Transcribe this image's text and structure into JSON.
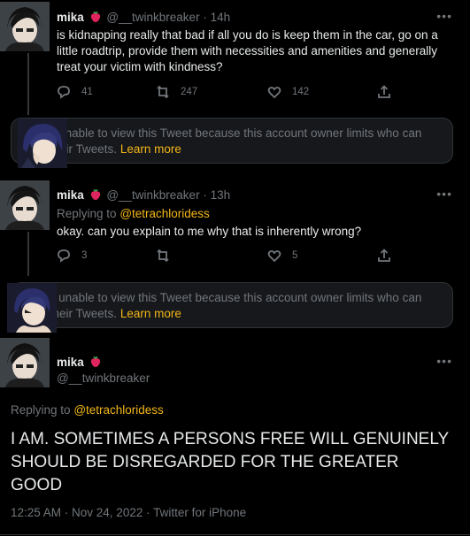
{
  "tweets": [
    {
      "name": "mika",
      "handle": "@__twinkbreaker",
      "time": "14h",
      "text": "is kidnapping really that bad if all you do is keep them in the car, go on a little roadtrip, provide them with necessities and amenities and generally treat your victim with kindness?",
      "counts": {
        "reply": "41",
        "retweet": "247",
        "like": "142"
      }
    },
    {
      "name": "mika",
      "handle": "@__twinkbreaker",
      "time": "13h",
      "reply_prefix": "Replying to",
      "reply_to": "@tetrachloridess",
      "text": "okay. can you explain to me why that is inherently wrong?",
      "counts": {
        "reply": "3",
        "retweet": "",
        "like": "5"
      }
    }
  ],
  "notices": [
    {
      "text": "You're unable to view this Tweet because this account owner limits who can view their Tweets.",
      "link": "Learn more"
    },
    {
      "text": "You're unable to view this Tweet because this account owner limits who can view their Tweets.",
      "link": "Learn more"
    }
  ],
  "main": {
    "name": "mika",
    "handle": "@__twinkbreaker",
    "reply_prefix": "Replying to",
    "reply_to": "@tetrachloridess",
    "text": "I AM. SOMETIMES  A PERSONS FREE WILL GENUINELY SHOULD BE DISREGARDED FOR THE GREATER GOOD",
    "meta": "12:25 AM · Nov 24, 2022 · Twitter for iPhone"
  },
  "icons": {
    "more": "more-dots-icon",
    "reply": "reply-bubble-icon",
    "retweet": "retweet-icon",
    "like": "heart-icon",
    "share": "share-icon",
    "emoji": "strawberry-icon"
  },
  "colors": {
    "accent": "#f2b616",
    "muted": "#71767b",
    "background": "#000000"
  }
}
